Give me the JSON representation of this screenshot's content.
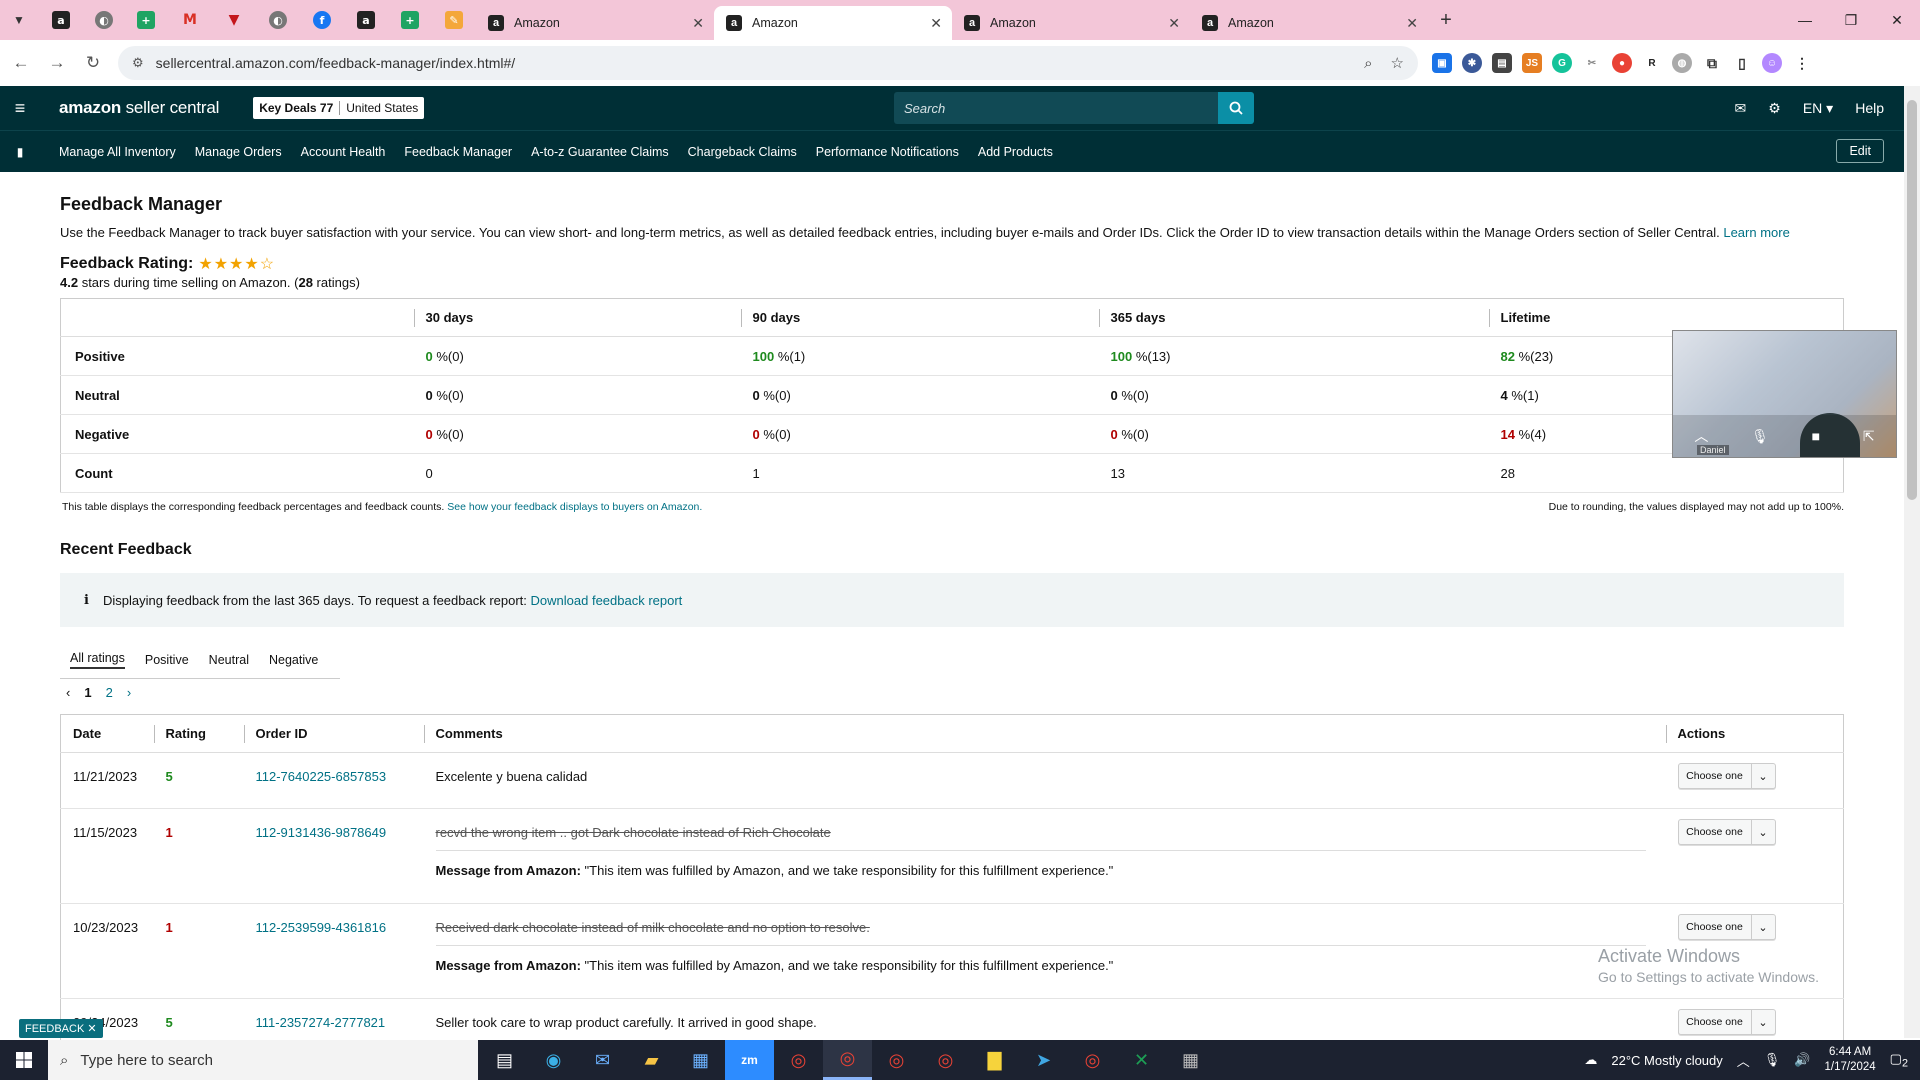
{
  "browser": {
    "tabs": [
      {
        "title": "Amazon",
        "active": false
      },
      {
        "title": "Amazon",
        "active": true
      },
      {
        "title": "Amazon",
        "active": false
      },
      {
        "title": "Amazon",
        "active": false
      }
    ],
    "url": "sellercentral.amazon.com/feedback-manager/index.html#/"
  },
  "header": {
    "logo_main": "amazon",
    "logo_sub": " seller central",
    "store": "Key Deals 77",
    "marketplace": "United States",
    "search_placeholder": "Search",
    "lang": "EN ▾",
    "help": "Help"
  },
  "nav": {
    "items": [
      "Manage All Inventory",
      "Manage Orders",
      "Account Health",
      "Feedback Manager",
      "A-to-z Guarantee Claims",
      "Chargeback Claims",
      "Performance Notifications",
      "Add Products"
    ],
    "edit": "Edit"
  },
  "page": {
    "title": "Feedback Manager",
    "description": "Use the Feedback Manager to track buyer satisfaction with your service. You can view short- and long-term metrics, as well as detailed feedback entries, including buyer e-mails and Order IDs. Click the Order ID to view transaction details within the Manage Orders section of Seller Central.",
    "learn_more": "Learn more",
    "rating_title": "Feedback Rating:",
    "rating_value": "4.2",
    "rating_text_a": " stars during time selling on Amazon. (",
    "rating_count": "28",
    "rating_text_b": " ratings)"
  },
  "stats": {
    "columns": [
      "",
      "30 days",
      "90 days",
      "365 days",
      "Lifetime"
    ],
    "rows": [
      {
        "label": "Positive",
        "cells": [
          [
            "0",
            " %(0)"
          ],
          [
            "100",
            " %(1)"
          ],
          [
            "100",
            " %(13)"
          ],
          [
            "82",
            " %(23)"
          ]
        ]
      },
      {
        "label": "Neutral",
        "cells": [
          [
            "0",
            " %(0)"
          ],
          [
            "0",
            " %(0)"
          ],
          [
            "0",
            " %(0)"
          ],
          [
            "4",
            " %(1)"
          ]
        ]
      },
      {
        "label": "Negative",
        "cells": [
          [
            "0",
            " %(0)"
          ],
          [
            "0",
            " %(0)"
          ],
          [
            "0",
            " %(0)"
          ],
          [
            "14",
            " %(4)"
          ]
        ]
      },
      {
        "label": "Count",
        "cells": [
          [
            "",
            "0"
          ],
          [
            "",
            "1"
          ],
          [
            "",
            "13"
          ],
          [
            "",
            "28"
          ]
        ]
      }
    ],
    "note_left": "This table displays the corresponding feedback percentages and feedback counts.",
    "note_link": "See how your feedback displays to buyers on Amazon.",
    "note_right": "Due to rounding, the values displayed may not add up to 100%."
  },
  "recent": {
    "title": "Recent Feedback",
    "info_icon": "i",
    "info_text": "Displaying feedback from the last 365 days. To request a feedback report:",
    "info_link": "Download feedback report",
    "filters": [
      "All ratings",
      "Positive",
      "Neutral",
      "Negative"
    ],
    "pager_prev": "‹",
    "pager_pages": [
      "1",
      "2"
    ],
    "pager_next": "›",
    "columns": [
      "Date",
      "Rating",
      "Order ID",
      "Comments",
      "Actions"
    ],
    "rows": [
      {
        "date": "11/21/2023",
        "rating": "5",
        "order": "112-7640225-6857853",
        "comment": "Excelente y buena calidad",
        "struck": false,
        "message_label": "",
        "message": ""
      },
      {
        "date": "11/15/2023",
        "rating": "1",
        "order": "112-9131436-9878649",
        "comment": "recvd the wrong item .. got Dark chocolate instead of Rich Chocolate",
        "struck": true,
        "message_label": "Message from Amazon:",
        "message": " \"This item was fulfilled by Amazon, and we take responsibility for this fulfillment experience.\""
      },
      {
        "date": "10/23/2023",
        "rating": "1",
        "order": "112-2539599-4361816",
        "comment": "Received dark chocolate instead of milk chocolate and no option to resolve.",
        "struck": true,
        "message_label": "Message from Amazon:",
        "message": " \"This item was fulfilled by Amazon, and we take responsibility for this fulfillment experience.\""
      },
      {
        "date": "09/24/2023",
        "rating": "5",
        "order": "111-2357274-2777821",
        "comment": "Seller took care to wrap product carefully. It arrived in good shape.",
        "struck": false,
        "message_label": "",
        "message": ""
      }
    ],
    "action_label": "Choose one"
  },
  "video": {
    "user": "Daniel"
  },
  "watermark": {
    "line1": "Activate Windows",
    "line2": "Go to Settings to activate Windows."
  },
  "feedback_tab": "FEEDBACK ✕",
  "taskbar": {
    "search_placeholder": "Type here to search",
    "weather": "22°C  Mostly cloudy",
    "time": "6:44 AM",
    "date": "1/17/2024",
    "notifications": "2"
  },
  "colors": {
    "header_bg": "#002f36",
    "link": "#007185",
    "positive": "#1e8a1e",
    "negative": "#b00000",
    "tabstrip": "#f3c6d8"
  }
}
